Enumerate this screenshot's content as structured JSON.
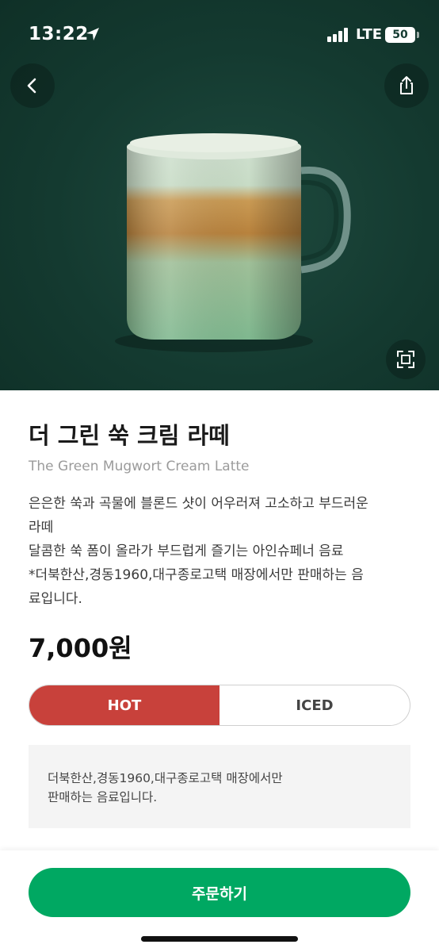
{
  "status_bar": {
    "time": "13:22",
    "network": "LTE",
    "battery": "50"
  },
  "header": {
    "back_icon": "chevron-left-icon",
    "share_icon": "share-icon",
    "fullscreen_icon": "fullscreen-icon"
  },
  "product": {
    "name": "더 그린 쑥 크림 라떼",
    "name_en": "The Green Mugwort Cream Latte",
    "description": [
      "은은한 쑥과 곡물에 블론드 샷이 어우러져 고소하고 부드러운\n라떼",
      "달콤한 쑥 폼이 올라가 부드럽게 즐기는 아인슈페너 음료",
      "*더북한산,경동1960,대구종로고택 매장에서만 판매하는 음\n료입니다."
    ],
    "price": "7,000원"
  },
  "temperature": {
    "options": [
      "HOT",
      "ICED"
    ],
    "selected": "HOT"
  },
  "notice": {
    "text": "더북한산,경동1960,대구종로고택 매장에서만\n판매하는 음료입니다."
  },
  "order_button": {
    "label": "주문하기"
  },
  "colors": {
    "hero_bg": "#143a30",
    "hot_active": "#c8413b",
    "order_green": "#00a862",
    "notice_bg": "#f4f4f4"
  }
}
